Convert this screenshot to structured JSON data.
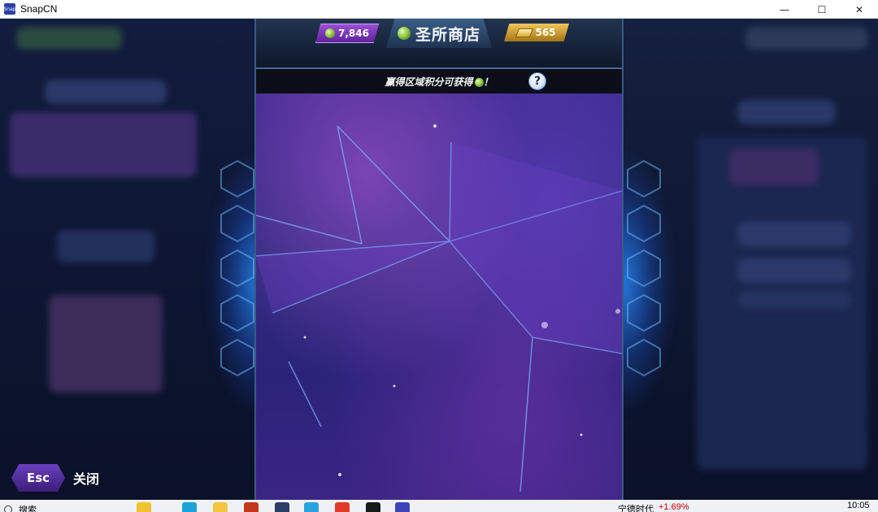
{
  "window": {
    "title": "SnapCN",
    "icon_label": "Snap",
    "controls": {
      "minimize": "—",
      "maximize": "☐",
      "close": "✕"
    }
  },
  "shop": {
    "title": "圣所商店",
    "purple_currency": "7,846",
    "gold_currency": "565",
    "info_text": "赢得区域积分可获得",
    "info_suffix": "！",
    "help_label": "?"
  },
  "footer": {
    "esc_label": "Esc",
    "close_label": "关闭"
  },
  "taskbar": {
    "search_label": "搜索",
    "stock_name": "宁德时代",
    "stock_change": "+1.69%",
    "clock": "10:05"
  },
  "colors": {
    "accent_purple": "#6a3fbc",
    "gold": "#f0c75a",
    "panel_border": "#3a5a86",
    "nebula": "#2d2a7c"
  }
}
